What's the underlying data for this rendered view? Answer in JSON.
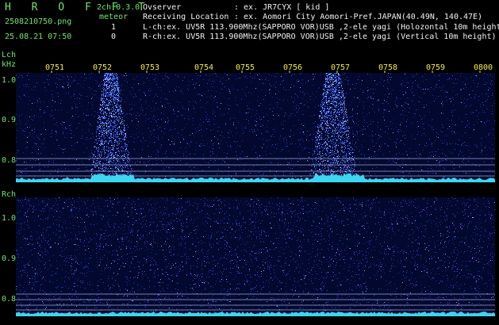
{
  "header": {
    "brand": "H R O F F T",
    "filename": "2508210750.png",
    "datetime": "25.08.21 07:50",
    "version": "2ch 0.3.0",
    "meteor_label": "meteor",
    "meteor_l": "1",
    "meteor_r": "0",
    "observer_label": "Ovserver",
    "observer_value": ": ex. JR7CYX [ kid ]",
    "location_label": "Receiving Location",
    "location_value": ": ex. Aomori City Aomori-Pref.JAPAN(40.49N, 140.47E)",
    "lch_info": "L-ch:ex. UV5R 113.900Mhz(SAPPORO VOR)USB ,2-ele yagi (Holozontal 10m height)",
    "rch_info": "R-ch:ex. UV5R 113.900Mhz(SAPPORO VOR)USB ,2-ele yagi (Vertical 10m height)"
  },
  "time_axis": [
    "0751",
    "0752",
    "0753",
    "0754",
    "0755",
    "0756",
    "0757",
    "0758",
    "0759",
    "0800"
  ],
  "lch": {
    "label": "Lch",
    "unit": "kHz",
    "ticks": [
      "1.0",
      "0.9",
      "0.8"
    ]
  },
  "rch": {
    "label": "Rch",
    "ticks": [
      "1.0",
      "0.9",
      "0.8"
    ]
  },
  "colors": {
    "label_green": "#6ee86a",
    "text_white": "#f2f2f2",
    "time_yellow": "#f5ee3a",
    "trace_cyan": "#3cd6f0",
    "noise_blue": "#1a3fd6"
  }
}
